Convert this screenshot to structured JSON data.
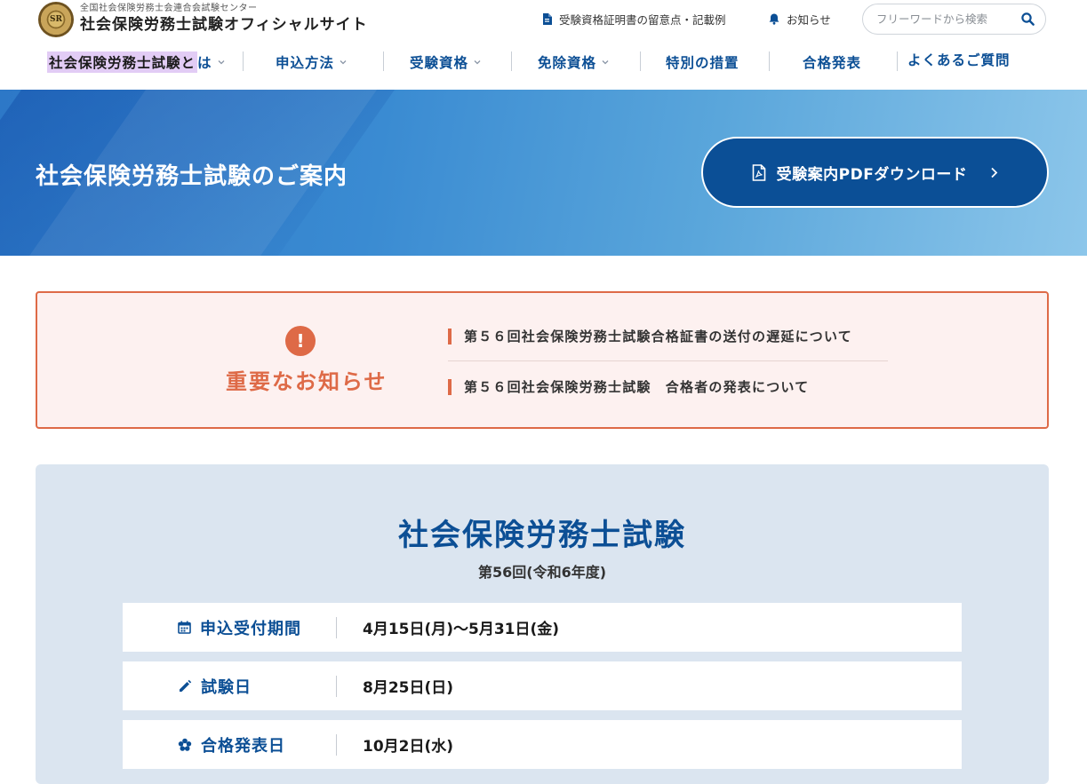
{
  "header": {
    "org_name": "全国社会保険労務士会連合会試験センター",
    "site_title": "社会保険労務士試験オフィシャルサイト",
    "logo_mark_text": "SR",
    "util_links": {
      "certificate": "受験資格証明書の留意点・記載例",
      "news": "お知らせ"
    },
    "search": {
      "placeholder": "フリーワードから検索"
    }
  },
  "nav": {
    "items": [
      {
        "label_highlight": "社会保険労務士試験と",
        "label_rest": "は"
      },
      {
        "label": "申込方法"
      },
      {
        "label": "受験資格"
      },
      {
        "label": "免除資格"
      },
      {
        "label": "特別の措置"
      },
      {
        "label": "合格発表"
      },
      {
        "label": "よくあるご質問"
      }
    ]
  },
  "hero": {
    "title": "社会保険労務士試験のご案内",
    "pdf_button": "受験案内PDFダウンロード"
  },
  "notice": {
    "icon": "!",
    "title": "重要なお知らせ",
    "links": [
      "第５６回社会保険労務士試験合格証書の送付の遅延について",
      "第５６回社会保険労務士試験　合格者の発表について"
    ]
  },
  "exam": {
    "title": "社会保険労務士試験",
    "subtitle": "第56回(令和6年度)",
    "rows": [
      {
        "icon": "calendar-icon",
        "label": "申込受付期間",
        "value": "4月15日(月)～5月31日(金)"
      },
      {
        "icon": "pencil-icon",
        "label": "試験日",
        "value": "8月25日(日)"
      },
      {
        "icon": "flower-icon",
        "label": "合格発表日",
        "value": "10月2日(水)"
      }
    ]
  },
  "colors": {
    "brand_blue": "#0c4f95",
    "notice_orange": "#de6a47",
    "notice_bg": "#fdf1f0",
    "panel_bg": "#dbe5f0"
  }
}
